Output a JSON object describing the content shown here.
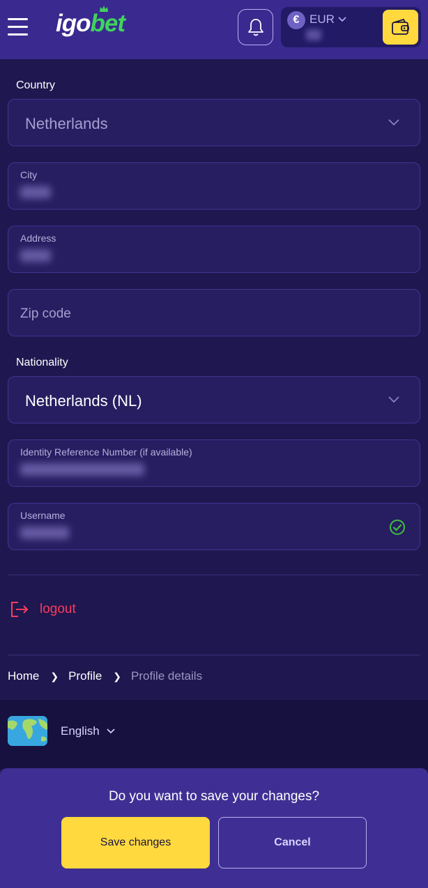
{
  "header": {
    "logo_part1": "igo",
    "logo_part2": "bet",
    "currency": "EUR",
    "currency_symbol": "€"
  },
  "form": {
    "country_label": "Country",
    "country_value": "Netherlands",
    "city_label": "City",
    "address_label": "Address",
    "zip_placeholder": "Zip code",
    "nationality_label": "Nationality",
    "nationality_value": "Netherlands (NL)",
    "identity_label": "Identity Reference Number (if available)",
    "username_label": "Username"
  },
  "logout_label": "logout",
  "breadcrumb": {
    "home": "Home",
    "profile": "Profile",
    "current": "Profile details"
  },
  "language": "English",
  "save_panel": {
    "question": "Do you want to save your changes?",
    "save_label": "Save changes",
    "cancel_label": "Cancel"
  },
  "colors": {
    "header_bg": "#3a2a8f",
    "page_bg": "#1f174f",
    "accent_yellow": "#ffd93d",
    "logo_green": "#3fd45c",
    "logout_red": "#ff3b5c",
    "success_green": "#3fbf3f"
  },
  "icons": {
    "menu": "hamburger-menu-icon",
    "notifications": "bell-icon",
    "wallet": "wallet-icon",
    "logout": "logout-icon",
    "valid": "check-circle-icon",
    "language": "globe-icon"
  }
}
